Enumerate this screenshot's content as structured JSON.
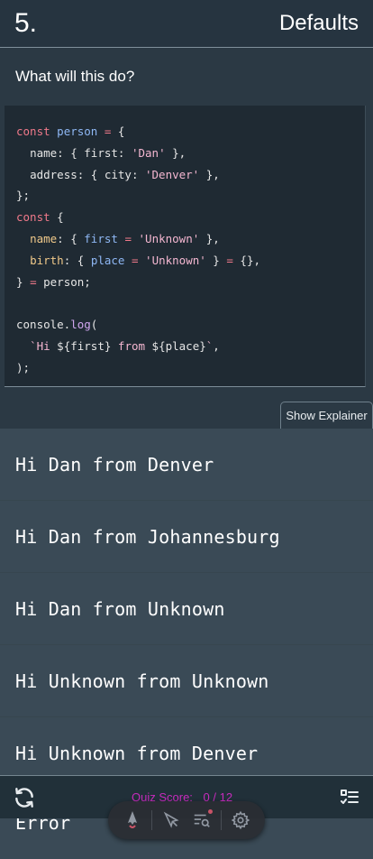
{
  "header": {
    "number": "5.",
    "title": "Defaults"
  },
  "question": {
    "prompt": "What will this do?",
    "show_explainer_label": "Show Explainer"
  },
  "code": {
    "lines": [
      "const person = {",
      "  name: { first: 'Dan' },",
      "  address: { city: 'Denver' },",
      "};",
      "const {",
      "  name: { first = 'Unknown' },",
      "  birth: { place = 'Unknown' } = {},",
      "} = person;",
      "",
      "console.log(",
      "  `Hi ${first} from ${place}`,",
      ");"
    ]
  },
  "answers": [
    "Hi Dan from Denver",
    "Hi Dan from Johannesburg",
    "Hi Dan from Unknown",
    "Hi Unknown from Unknown",
    "Hi Unknown from Denver",
    "Error"
  ],
  "footer": {
    "score_label": "Quiz Score:",
    "score_value": "0 / 12",
    "refresh_icon": "refresh-icon",
    "list_icon": "checklist-icon"
  },
  "toolbar": {
    "icons": [
      "astro-icon",
      "inspect-icon",
      "audit-icon",
      "settings-icon"
    ]
  },
  "colors": {
    "background": "#2b3944",
    "code_background": "#1f2a33",
    "answer_background": "#3a4a56",
    "score": "#c72bbd"
  }
}
